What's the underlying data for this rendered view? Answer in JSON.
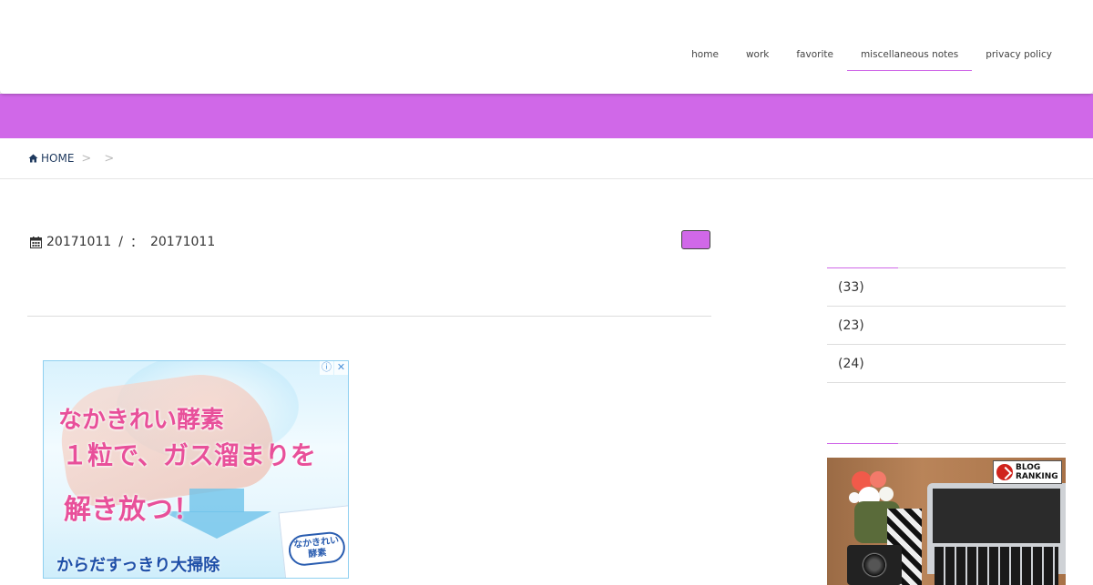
{
  "nav": {
    "items": [
      {
        "label": "home"
      },
      {
        "label": "work"
      },
      {
        "label": "favorite"
      },
      {
        "label": "miscellaneous notes",
        "active": true
      },
      {
        "label": "privacy policy"
      }
    ]
  },
  "theme": {
    "accent": "#d068e8"
  },
  "breadcrumb": {
    "home": "HOME",
    "sep1": ">",
    "sep2": ">"
  },
  "post": {
    "date_published": "20171011",
    "separator": "/",
    "updated_label": "：",
    "date_updated": "20171011"
  },
  "ad": {
    "line1": "なかきれい酵素",
    "line2": "１粒で、ガス溜まりを",
    "line3": "解き放つ！",
    "line4": "からだすっきり大掃除",
    "package_label": "なかきれい 酵素",
    "choices_icon": "ⓘ",
    "close_icon": "✕"
  },
  "sidebar": {
    "categories": [
      {
        "label": "(33)"
      },
      {
        "label": "(23)"
      },
      {
        "label": "(24)"
      }
    ],
    "banner": {
      "badge_line1": "BLOG",
      "badge_line2": "RANKING"
    }
  }
}
